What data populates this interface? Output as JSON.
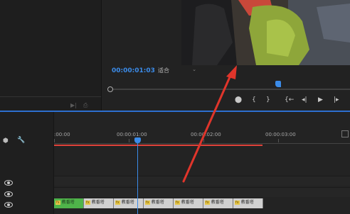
{
  "program": {
    "timecode": "00:00:01:03",
    "fit_value": "适合",
    "transport": [
      "⬤",
      "{",
      "}",
      "{←",
      "◂|",
      "▶",
      "|▸"
    ]
  },
  "timeline": {
    "ruler_labels": [
      ":00:00",
      "00:00:01:00",
      "00:00:02:00",
      "00:00:03:00"
    ],
    "clip_label": "教番塔",
    "clip_fx": "fx"
  },
  "colors": {
    "accent_blue": "#3b8be8",
    "work_area_red": "#e0423a",
    "annotation_red": "#e0352b",
    "clip_green": "#4fb44a"
  }
}
